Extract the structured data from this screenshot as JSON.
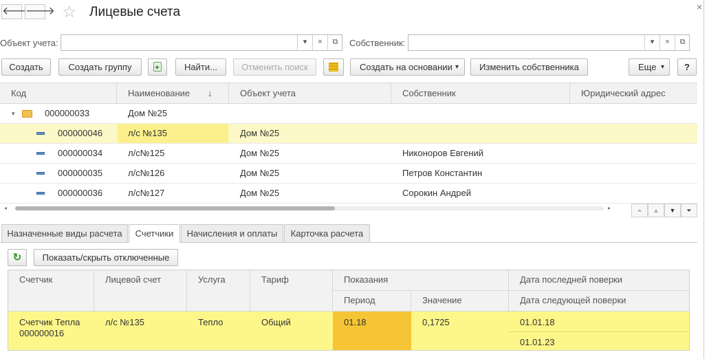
{
  "window": {
    "title": "Лицевые счета"
  },
  "nav": {
    "back": "🡐",
    "forward": "🡒",
    "star": "☆"
  },
  "filters": {
    "object_label": "Объект учета:",
    "object_value": "",
    "owner_label": "Собственник:",
    "owner_value": ""
  },
  "toolbar": {
    "create": "Создать",
    "create_group": "Создать группу",
    "find": "Найти...",
    "cancel_search": "Отменить поиск",
    "create_based": "Создать на основании",
    "change_owner": "Изменить собственника",
    "more": "Еще",
    "help": "?"
  },
  "table": {
    "columns": [
      "Код",
      "Наименование",
      "Объект учета",
      "Собственник",
      "Юридический адрес"
    ],
    "sort_indicator": "↓",
    "group": {
      "code": "000000033",
      "name": "Дом №25"
    },
    "rows": [
      {
        "code": "000000046",
        "name": "л/с №135",
        "object": "Дом №25",
        "owner": "",
        "address": ""
      },
      {
        "code": "000000034",
        "name": "л/с№125",
        "object": "Дом №25",
        "owner": "Никоноров Евгений",
        "address": ""
      },
      {
        "code": "000000035",
        "name": "л/с№126",
        "object": "Дом №25",
        "owner": "Петров Константин",
        "address": ""
      },
      {
        "code": "000000036",
        "name": "л/с№127",
        "object": "Дом №25",
        "owner": "Сорокин Андрей",
        "address": ""
      }
    ]
  },
  "tabs": [
    "Назначенные виды расчета",
    "Счетчики",
    "Начисления и оплаты",
    "Карточка расчета"
  ],
  "meters": {
    "show_hide_label": "Показать/скрыть отключенные",
    "headers": {
      "meter": "Счетчик",
      "account": "Лицевой счет",
      "service": "Услуга",
      "tariff": "Тариф",
      "readings": "Показания",
      "period": "Период",
      "value": "Значение",
      "last_check": "Дата последней поверки",
      "next_check": "Дата следующей поверки"
    },
    "row": {
      "meter_line1": "Счетчик Тепла",
      "meter_line2": "000000016",
      "account": "л/с №135",
      "service": "Тепло",
      "tariff": "Общий",
      "period": "01.18",
      "value": "0,1725",
      "last_check": "01.01.18",
      "next_check": "01.01.23"
    }
  },
  "colors": {
    "selected_row": "#fdf8c8",
    "selected_cell": "#fbf08c",
    "meter_row": "#fdf78a",
    "period_cell": "#f5c535"
  }
}
